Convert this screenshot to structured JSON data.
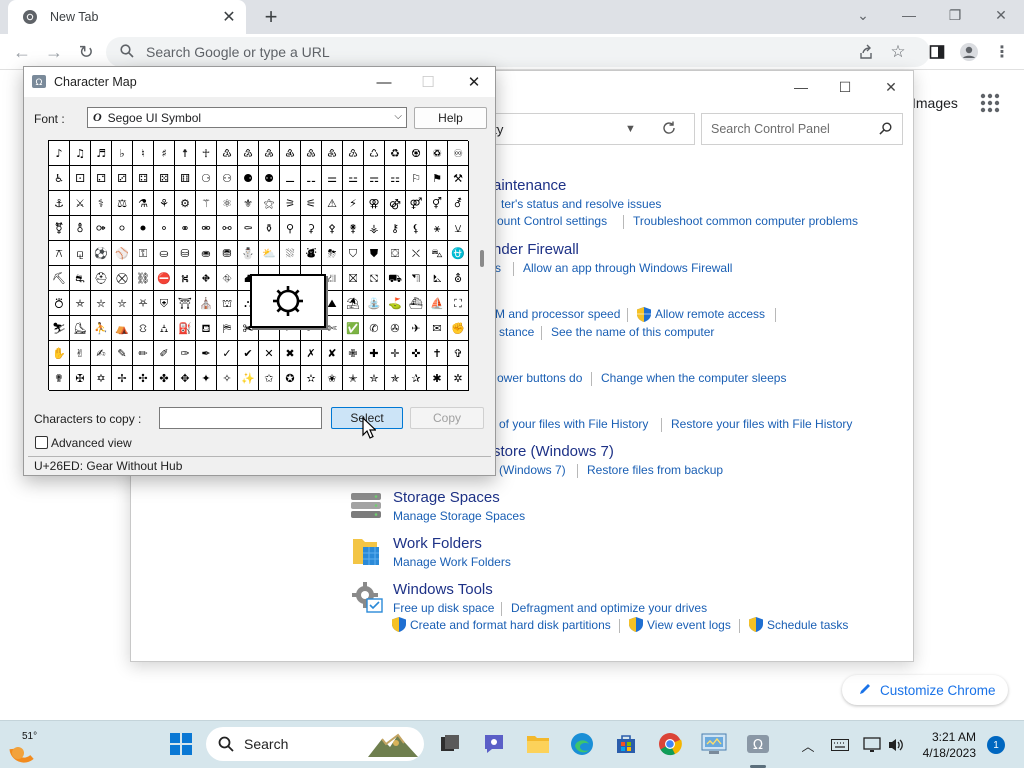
{
  "browser": {
    "tab_title": "New Tab",
    "omnibox_placeholder": "Search Google or type a URL",
    "images_link": "Images",
    "customize_label": "Customize Chrome"
  },
  "control_panel": {
    "address_text": "rity",
    "search_placeholder": "Search Control Panel",
    "sections": [
      {
        "heading": "aintenance",
        "links": [
          "ter's status and resolve issues",
          "ount Control settings",
          "Troubleshoot common computer problems"
        ]
      },
      {
        "heading": "nder Firewall",
        "links": [
          "s",
          "Allow an app through Windows Firewall"
        ]
      },
      {
        "heading": "",
        "links": [
          "M and processor speed",
          "Allow remote access",
          "stance",
          "See the name of this computer"
        ]
      },
      {
        "heading": "",
        "links": [
          "ower buttons do",
          "Change when the computer sleeps"
        ]
      },
      {
        "heading": "",
        "links": [
          "of your files with File History",
          "Restore your files with File History"
        ]
      },
      {
        "heading": "store (Windows 7)",
        "links": [
          "(Windows 7)",
          "Restore files from backup"
        ]
      },
      {
        "heading": "Storage Spaces",
        "links": [
          "Manage Storage Spaces"
        ]
      },
      {
        "heading": "Work Folders",
        "links": [
          "Manage Work Folders"
        ]
      },
      {
        "heading": "Windows Tools",
        "links": [
          "Free up disk space",
          "Defragment and optimize your drives",
          "Create and format hard disk partitions",
          "View event logs",
          "Schedule tasks"
        ]
      }
    ]
  },
  "charmap": {
    "title": "Character Map",
    "font_label": "Font :",
    "font_value": "Segoe UI Symbol",
    "font_icon": "O",
    "help_label": "Help",
    "chars_label": "Characters to copy :",
    "chars_value": "",
    "select_label": "Select",
    "copy_label": "Copy",
    "advanced_label": "Advanced view",
    "advanced_checked": false,
    "status": "U+26ED: Gear Without Hub",
    "magnified_char": "⛭",
    "grid": [
      [
        "♪",
        "♫",
        "♬",
        "♭",
        "♮",
        "♯",
        "☨",
        "☥",
        "♳",
        "♴",
        "♵",
        "♶",
        "♷",
        "♸",
        "♹",
        "♺",
        "♻",
        "♼",
        "♽",
        "♾"
      ],
      [
        "♿",
        "⚀",
        "⚁",
        "⚂",
        "⚃",
        "⚄",
        "⚅",
        "⚆",
        "⚇",
        "⚈",
        "⚉",
        "⚊",
        "⚋",
        "⚌",
        "⚍",
        "⚎",
        "⚏",
        "⚐",
        "⚑",
        "⚒"
      ],
      [
        "⚓",
        "⚔",
        "⚕",
        "⚖",
        "⚗",
        "⚘",
        "⚙",
        "⚚",
        "⚛",
        "⚜",
        "⚝",
        "⚞",
        "⚟",
        "⚠",
        "⚡",
        "⚢",
        "⚣",
        "⚤",
        "⚥",
        "⚦"
      ],
      [
        "⚧",
        "⚨",
        "⚩",
        "⚪",
        "⚫",
        "⚬",
        "⚭",
        "⚮",
        "⚯",
        "⚰",
        "⚱",
        "⚲",
        "⚳",
        "⚴",
        "⚵",
        "⚶",
        "⚷",
        "⚸",
        "⚹",
        "⚺"
      ],
      [
        "⚻",
        "⚼",
        "⚽",
        "⚾",
        "⚿",
        "⛀",
        "⛁",
        "⛂",
        "⛃",
        "⛄",
        "⛅",
        "⛆",
        "⛇",
        "⛈",
        "⛉",
        "⛊",
        "⛋",
        "⛌",
        "⛍",
        "⛎"
      ],
      [
        "⛏",
        "⛐",
        "⛑",
        "⛒",
        "⛓",
        "⛔",
        "⛕",
        "⛖",
        "⛗",
        "⛘",
        "⛙",
        "⛚",
        "⛛",
        "⛜",
        "⛝",
        "⛞",
        "⛟",
        "⛠",
        "⛡",
        "⛢"
      ],
      [
        "⛣",
        "⛤",
        "⛥",
        "⛦",
        "⛧",
        "⛨",
        "⛩",
        "⛪",
        "⛫",
        "⛬",
        "⛭",
        "⛮",
        "⛯",
        "⛰",
        "⛱",
        "⛲",
        "⛳",
        "⛴",
        "⛵",
        "⛶"
      ],
      [
        "⛷",
        "⛸",
        "⛹",
        "⛺",
        "⛻",
        "⛼",
        "⛽",
        "⛾",
        "⛿",
        "✀",
        "✁",
        "✂",
        "✃",
        "✄",
        "✅",
        "✆",
        "✇",
        "✈",
        "✉",
        "✊"
      ],
      [
        "✋",
        "✌",
        "✍",
        "✎",
        "✏",
        "✐",
        "✑",
        "✒",
        "✓",
        "✔",
        "✕",
        "✖",
        "✗",
        "✘",
        "✙",
        "✚",
        "✛",
        "✜",
        "✝",
        "✞"
      ],
      [
        "✟",
        "✠",
        "✡",
        "✢",
        "✣",
        "✤",
        "✥",
        "✦",
        "✧",
        "✨",
        "✩",
        "✪",
        "✫",
        "✬",
        "✭",
        "✮",
        "✯",
        "✰",
        "✱",
        "✲"
      ]
    ]
  },
  "taskbar": {
    "weather_temp": "51°",
    "search_label": "Search",
    "time": "3:21 AM",
    "date": "4/18/2023",
    "notification_count": "1"
  },
  "colors": {
    "accent": "#0078d4",
    "link": "#1a5fb4",
    "heading": "#1e3287",
    "chrome_blue": "#1a73e8"
  }
}
